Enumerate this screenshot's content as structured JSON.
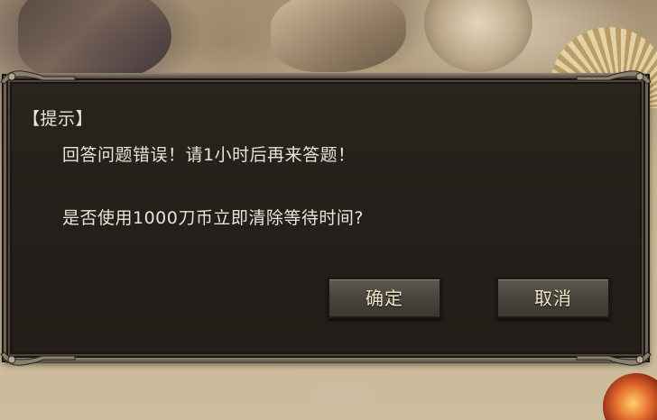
{
  "dialog": {
    "title": "【提示】",
    "message_line1": "回答问题错误！请1小时后再来答题！",
    "message_line2": "是否使用1000刀币立即清除等待时间?",
    "confirm_label": "确定",
    "cancel_label": "取消"
  },
  "colors": {
    "dialog_bg": "#241f1a",
    "dialog_border": "#6e6457",
    "text": "#e8e4d8",
    "button_text": "#f1e7c6"
  }
}
